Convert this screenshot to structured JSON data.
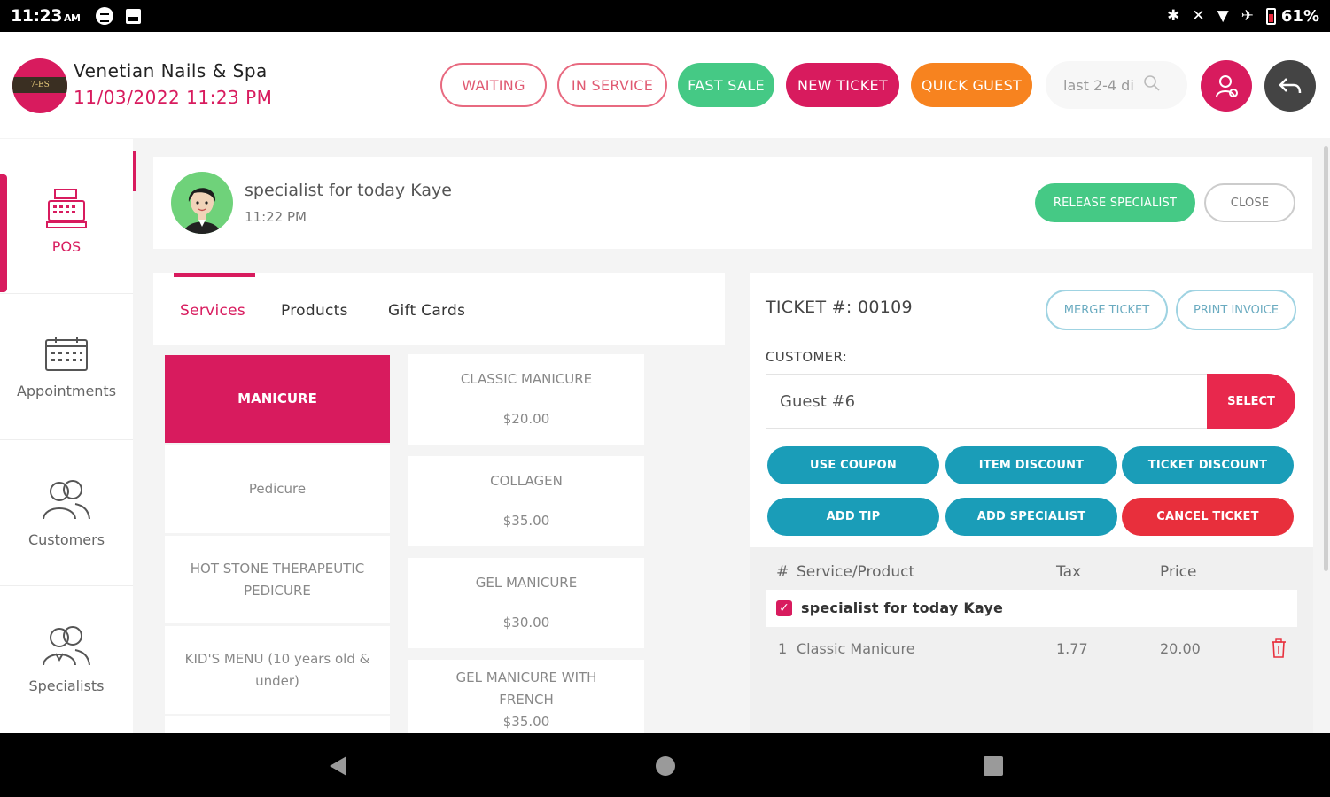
{
  "status_bar": {
    "time": "11:23",
    "ampm": "AM",
    "battery": "61%"
  },
  "header": {
    "salon_name": "Venetian Nails & Spa",
    "datetime": "11/03/2022 11:23 PM",
    "logo_text": "7-ES",
    "buttons": {
      "waiting": "WAITING",
      "in_service": "IN SERVICE",
      "fast_sale": "FAST SALE",
      "new_ticket": "NEW TICKET",
      "quick_guest": "QUICK GUEST"
    },
    "search": {
      "value": "last 2-4 di"
    }
  },
  "sidebar": {
    "items": [
      {
        "label": "POS",
        "icon": "cash-register-icon",
        "active": true
      },
      {
        "label": "Appointments",
        "icon": "calendar-icon",
        "active": false
      },
      {
        "label": "Customers",
        "icon": "customers-icon",
        "active": false
      },
      {
        "label": "Specialists",
        "icon": "specialists-icon",
        "active": false
      }
    ]
  },
  "specialist": {
    "name": "specialist for today Kaye",
    "time": "11:22 PM",
    "release_label": "RELEASE SPECIALIST",
    "close_label": "CLOSE"
  },
  "catalog": {
    "tabs": [
      "Services",
      "Products",
      "Gift Cards"
    ],
    "active_tab": "Services",
    "categories": [
      "MANICURE",
      "Pedicure",
      "HOT STONE THERAPEUTIC PEDICURE",
      "KID'S MENU (10 years old & under)"
    ],
    "services": [
      {
        "name": "CLASSIC MANICURE",
        "price": "$20.00"
      },
      {
        "name": "COLLAGEN",
        "price": "$35.00"
      },
      {
        "name": "GEL MANICURE",
        "price": "$30.00"
      },
      {
        "name": "GEL MANICURE WITH FRENCH",
        "price": "$35.00"
      }
    ]
  },
  "ticket": {
    "number_label": "TICKET #: 00109",
    "merge_label": "MERGE TICKET",
    "print_label": "PRINT INVOICE",
    "customer_label": "CUSTOMER:",
    "customer_value": "Guest #6",
    "select_label": "SELECT",
    "actions": {
      "use_coupon": "USE COUPON",
      "item_discount": "ITEM DISCOUNT",
      "ticket_discount": "TICKET DISCOUNT",
      "add_tip": "ADD TIP",
      "add_specialist": "ADD SPECIALIST",
      "cancel_ticket": "CANCEL TICKET"
    },
    "table": {
      "col_num": "#",
      "col_service": "Service/Product",
      "col_tax": "Tax",
      "col_price": "Price",
      "group": "specialist for today Kaye",
      "rows": [
        {
          "num": "1",
          "service": "Classic Manicure",
          "tax": "1.77",
          "price": "20.00"
        }
      ]
    }
  },
  "colors": {
    "brand_pink": "#d81b5e",
    "green": "#45c985",
    "orange": "#f7831f",
    "teal": "#1a9db8",
    "red": "#e82f3c"
  }
}
